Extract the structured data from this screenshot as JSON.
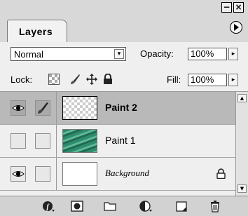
{
  "window": {
    "minimize_glyph": "−",
    "close_glyph": "×"
  },
  "tab": {
    "label": "Layers"
  },
  "blend_mode": {
    "value": "Normal"
  },
  "opacity": {
    "label": "Opacity:",
    "value": "100%"
  },
  "lock": {
    "label": "Lock:",
    "icons": [
      "lock-transparent-icon",
      "lock-image-icon",
      "lock-position-icon",
      "lock-all-icon"
    ]
  },
  "fill": {
    "label": "Fill:",
    "value": "100%"
  },
  "layers": [
    {
      "name": "Paint 2",
      "visible": true,
      "brush": true,
      "selected": true,
      "thumbnail": "transparent"
    },
    {
      "name": "Paint 1",
      "visible": false,
      "brush": false,
      "selected": false,
      "thumbnail": "paint"
    },
    {
      "name": "Background",
      "visible": true,
      "brush": false,
      "selected": false,
      "thumbnail": "white",
      "locked": true
    }
  ],
  "toolbar": {
    "icons": [
      "layer-style-icon",
      "layer-mask-icon",
      "layer-group-icon",
      "adjustment-layer-icon",
      "new-layer-icon",
      "trash-icon"
    ]
  },
  "colors": {
    "panel": "#e6e6e6",
    "selected_row": "#b9b9b9"
  }
}
